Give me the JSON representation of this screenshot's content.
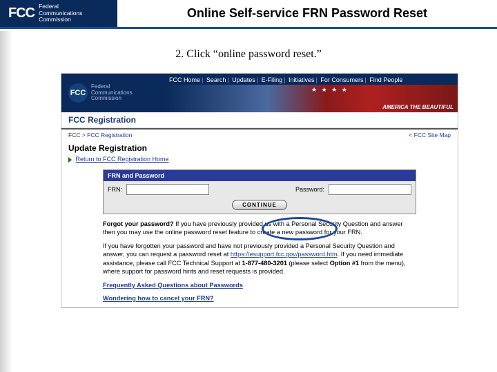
{
  "slide": {
    "logo_mark": "FCC",
    "logo_line1": "Federal",
    "logo_line2": "Communications",
    "logo_line3": "Commission",
    "title": "Online Self-service FRN Password Reset"
  },
  "instruction": "2. Click “online password reset.”",
  "embed": {
    "logo_mark": "FCC",
    "logo_line1": "Federal",
    "logo_line2": "Communications",
    "logo_line3": "Commission",
    "nav": [
      "FCC Home",
      "Search",
      "Updates",
      "E-Filing",
      "Initiatives",
      "For Consumers",
      "Find People"
    ],
    "banner_motto": "AMERICA THE BEAUTIFUL",
    "banner_stars": "★ ★ ★ ★",
    "reg_title": "FCC Registration",
    "breadcrumb_left_prefix": "FCC > ",
    "breadcrumb_left_link": "FCC Registration",
    "breadcrumb_right": "< FCC Site Map",
    "section_title": "Update Registration",
    "return_link": "Return to FCC Registration Home",
    "form": {
      "header": "FRN and Password",
      "frn_label": "FRN:",
      "frn_value": "",
      "pw_label": "Password:",
      "pw_value": "",
      "continue": "CONTINUE"
    },
    "para1_lead": "Forgot your password?",
    "para1_rest": " If you have previously provided us with a Personal Security Question and answer then you may use the online password reset feature to create a new password for your FRN.",
    "para2_a": "If you have forgotten your password and have not previously provided a Personal Security Question and answer, you can request a password reset at ",
    "para2_link": "https://esupport.fcc.gov/password.htm",
    "para2_b": ". If you need immediate assistance, please call FCC Technical Support at ",
    "para2_phone": "1-877-480-3201",
    "para2_c": " (please select ",
    "para2_option": "Option #1",
    "para2_d": " from the menu), where support for password hints and reset requests is provided.",
    "faq_link": "Frequently Asked Questions about Passwords",
    "cancel_link": "Wondering how to cancel your FRN?"
  }
}
